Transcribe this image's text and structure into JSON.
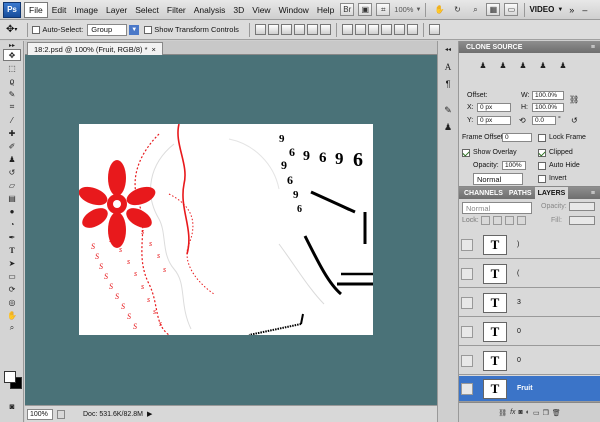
{
  "menubar": {
    "logo": "Ps",
    "items": [
      "File",
      "Edit",
      "Image",
      "Layer",
      "Select",
      "Filter",
      "Analysis",
      "3D",
      "View",
      "Window",
      "Help"
    ],
    "zoom": "100%",
    "workspace": "VIDEO"
  },
  "options": {
    "auto_select_label": "Auto-Select:",
    "auto_select_value": "Group",
    "transform_label": "Show Transform Controls"
  },
  "document": {
    "tab_title": "18:2.psd @ 100% (Fruit, RGB/8) *"
  },
  "status": {
    "zoom": "100%",
    "doc_info": "Doc: 531.6K/82.8M"
  },
  "clone_source": {
    "tab": "CLONE SOURCE",
    "offset_label": "Offset:",
    "x_label": "X:",
    "x_value": "0 px",
    "y_label": "Y:",
    "y_value": "0 px",
    "w_label": "W:",
    "w_value": "100.0%",
    "h_label": "H:",
    "h_value": "100.0%",
    "angle_value": "0.0",
    "angle_unit": "°",
    "frame_offset_label": "Frame Offset:",
    "frame_offset_value": "0",
    "lock_frame_label": "Lock Frame",
    "show_overlay_label": "Show Overlay",
    "clipped_label": "Clipped",
    "opacity_label": "Opacity:",
    "opacity_value": "100%",
    "auto_hide_label": "Auto Hide",
    "blend_mode": "Normal",
    "invert_label": "Invert"
  },
  "layers": {
    "tabs": [
      "CHANNELS",
      "PATHS",
      "LAYERS"
    ],
    "blend_mode": "Normal",
    "opacity_label": "Opacity:",
    "lock_label": "Lock:",
    "fill_label": "Fill:",
    "rows": [
      {
        "name": ")"
      },
      {
        "name": "("
      },
      {
        "name": "3"
      },
      {
        "name": "0"
      },
      {
        "name": "0"
      },
      {
        "name": "Fruit"
      }
    ],
    "thumb_glyph": "T"
  },
  "colors": {
    "canvas_bg": "#4a7278",
    "selection": "#3b74c8",
    "flower_red": "#e8191c"
  }
}
